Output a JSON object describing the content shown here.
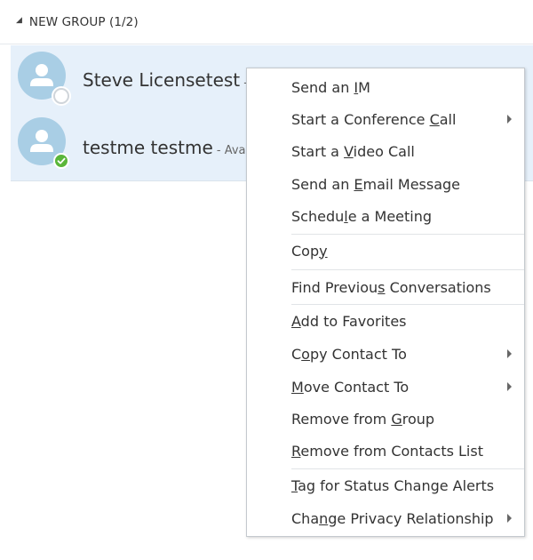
{
  "group": {
    "title": "NEW GROUP (1/2)"
  },
  "contacts": [
    {
      "name": "Steve Licensetest",
      "status": " - ",
      "presence": "offline"
    },
    {
      "name": "testme testme",
      "status": " - Ava",
      "presence": "available"
    }
  ],
  "menu": {
    "items": [
      {
        "pre": "Send an ",
        "key": "I",
        "post": "M",
        "submenu": false
      },
      {
        "pre": "Start a Conference ",
        "key": "C",
        "post": "all",
        "submenu": true
      },
      {
        "pre": "Start a ",
        "key": "V",
        "post": "ideo Call",
        "submenu": false
      },
      {
        "pre": "Send an ",
        "key": "E",
        "post": "mail Message",
        "submenu": false
      },
      {
        "pre": "Schedu",
        "key": "l",
        "post": "e a Meeting",
        "submenu": false
      },
      {
        "pre": "Cop",
        "key": "y",
        "post": "",
        "submenu": false
      },
      {
        "pre": "Find Previou",
        "key": "s",
        "post": " Conversations",
        "submenu": false
      },
      {
        "pre": "",
        "key": "A",
        "post": "dd to Favorites",
        "submenu": false
      },
      {
        "pre": "C",
        "key": "o",
        "post": "py Contact To",
        "submenu": true
      },
      {
        "pre": "",
        "key": "M",
        "post": "ove Contact To",
        "submenu": true
      },
      {
        "pre": "Remove from ",
        "key": "G",
        "post": "roup",
        "submenu": false
      },
      {
        "pre": "",
        "key": "R",
        "post": "emove from Contacts List",
        "submenu": false
      },
      {
        "pre": "",
        "key": "T",
        "post": "ag for Status Change Alerts",
        "submenu": false
      },
      {
        "pre": "Cha",
        "key": "n",
        "post": "ge Privacy Relationship",
        "submenu": true
      }
    ]
  },
  "colors": {
    "selection": "#e6f0fa",
    "avatar": "#a9cee5",
    "available": "#5ab63a"
  }
}
